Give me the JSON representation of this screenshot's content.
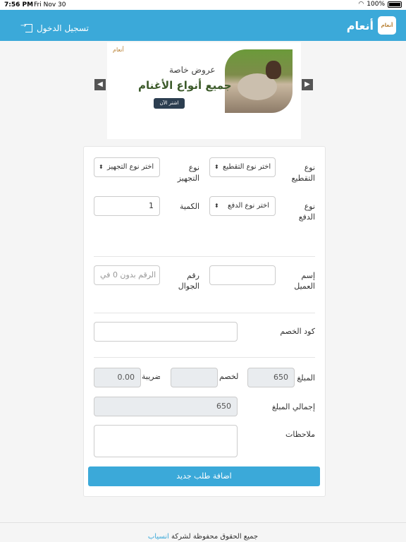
{
  "status_bar": {
    "time": "7:56 PM",
    "date": "Fri Nov 30",
    "battery": "100%"
  },
  "navbar": {
    "brand": "أنعام",
    "logo_text": "أنعام",
    "login_label": "تسجيل الدخول"
  },
  "banner": {
    "mark": "أنعام",
    "subtitle": "عروض خاصة",
    "title": "جميع أنواع الأغنام",
    "cta": "اشتر الآن"
  },
  "form": {
    "cut_type": {
      "label": "نوع التقطيع",
      "value": "اختر نوع التقطيع"
    },
    "packaging_type": {
      "label": "نوع التجهيز",
      "value": "اختر نوع التجهيز"
    },
    "payment_type": {
      "label": "نوع الدفع",
      "value": "اختر نوع الدفع"
    },
    "quantity": {
      "label": "الكمية",
      "value": "1"
    },
    "customer_name": {
      "label": "إسم العميل",
      "value": ""
    },
    "mobile": {
      "label": "رقم الجوال",
      "placeholder": "الرقم بدون 0 في"
    },
    "discount_code": {
      "label": "كود الخصم",
      "value": ""
    },
    "amount": {
      "label": "المبلغ",
      "value": "650"
    },
    "discount": {
      "label": "الخصم",
      "value": ""
    },
    "tax": {
      "label": "الضريبة",
      "value": "0.00"
    },
    "total": {
      "label": "إجمالي المبلغ",
      "value": "650"
    },
    "notes": {
      "label": "ملاحظات",
      "value": ""
    },
    "submit_label": "اضافة طلب جديد"
  },
  "footer": {
    "text": "جميع الحقوق محفوظة لشركة",
    "company": "انسياب"
  }
}
